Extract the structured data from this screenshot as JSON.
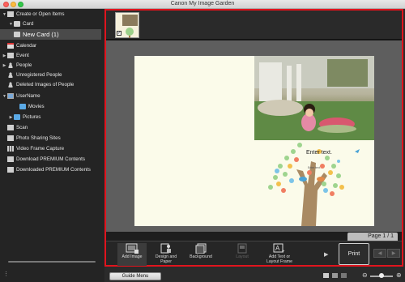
{
  "window": {
    "title": "Canon My Image Garden"
  },
  "sidebar": {
    "items": [
      {
        "label": "Create or Open Items"
      },
      {
        "label": "Card"
      },
      {
        "label": "New Card (1)"
      },
      {
        "label": "Calendar"
      },
      {
        "label": "Event"
      },
      {
        "label": "People"
      },
      {
        "label": "Unregistered People"
      },
      {
        "label": "Deleted Images of People"
      },
      {
        "label": "UserName"
      },
      {
        "label": "Movies"
      },
      {
        "label": "Pictures"
      },
      {
        "label": "Scan"
      },
      {
        "label": "Photo Sharing Sites"
      },
      {
        "label": "Video Frame Capture"
      },
      {
        "label": "Download PREMIUM Contents"
      },
      {
        "label": "Downloaded PREMIUM Contents"
      }
    ]
  },
  "canvas": {
    "enter_text": "Enter text.",
    "enter_text_small": "Enter text.",
    "page_indicator": "Page 1 / 1"
  },
  "toolbar": {
    "add_image": "Add Image",
    "design_paper": "Design and Paper",
    "background": "Background",
    "layout": "Layout",
    "add_text": "Add Text or Layout Frame",
    "print": "Print"
  },
  "status": {
    "guide_menu": "Guide Menu"
  },
  "colors": {
    "highlight": "#e0141e"
  }
}
